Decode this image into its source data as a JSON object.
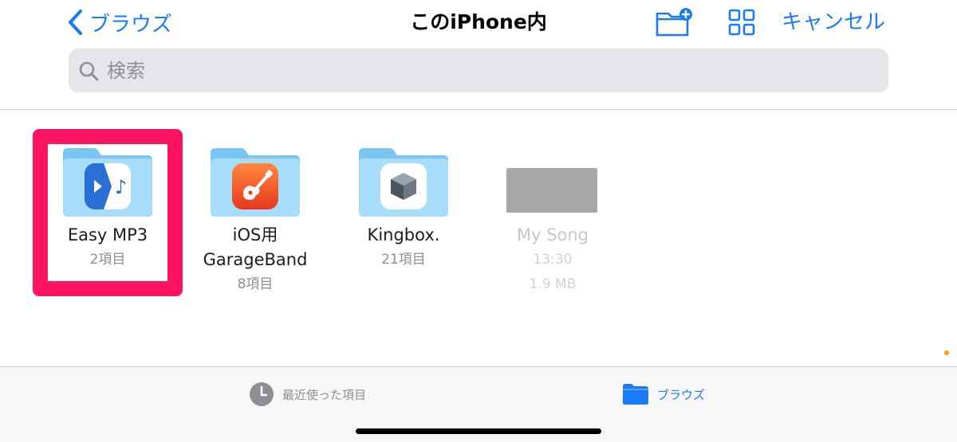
{
  "nav": {
    "back_label": "ブラウズ",
    "title": "このiPhone内",
    "cancel_label": "キャンセル"
  },
  "search": {
    "placeholder": "検索"
  },
  "items": [
    {
      "name": "Easy MP3",
      "meta": [
        "2項目"
      ],
      "icon": "easy-mp3-icon",
      "selected": true
    },
    {
      "name": "iOS用",
      "name2": "GarageBand",
      "meta": [
        "8項目"
      ],
      "icon": "guitar-icon"
    },
    {
      "name": "Kingbox.",
      "meta": [
        "21項目"
      ],
      "icon": "box-icon"
    },
    {
      "name": "My Song",
      "meta": [
        "13:30",
        "1.9 MB"
      ],
      "icon": "song-thumbnail",
      "dimmed": true
    }
  ],
  "tabbar": {
    "recents_label": "最近使った項目",
    "browse_label": "ブラウズ"
  },
  "colors": {
    "accent": "#1a7cf4",
    "folder_light": "#a8dcfb",
    "folder_dark": "#7cc5f2",
    "highlight": "#ff1464"
  }
}
